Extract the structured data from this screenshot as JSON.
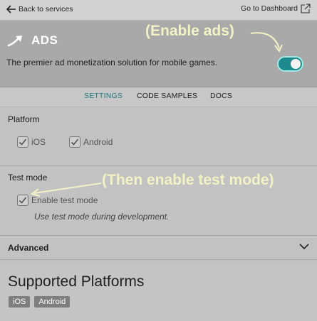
{
  "topbar": {
    "back_label": "Back to services",
    "dashboard_label": "Go to Dashboard"
  },
  "service": {
    "name": "ADS",
    "description": "The premier ad monetization solution for mobile games.",
    "enabled": true
  },
  "annotations": {
    "enable_ads": "(Enable ads)",
    "enable_test_mode": "(Then enable test mode)"
  },
  "tabs": [
    {
      "label": "SETTINGS",
      "active": true
    },
    {
      "label": "CODE SAMPLES",
      "active": false
    },
    {
      "label": "DOCS",
      "active": false
    }
  ],
  "platform": {
    "title": "Platform",
    "options": [
      {
        "label": "iOS",
        "checked": true
      },
      {
        "label": "Android",
        "checked": true
      }
    ]
  },
  "test_mode": {
    "title": "Test mode",
    "checkbox_label": "Enable test mode",
    "checked": true,
    "hint": "Use test mode during development."
  },
  "advanced": {
    "title": "Advanced"
  },
  "supported": {
    "title": "Supported Platforms",
    "platforms": [
      "iOS",
      "Android"
    ]
  },
  "colors": {
    "accent": "#1d8a8e",
    "annotation": "#f2f2c6"
  },
  "icons": [
    "back-arrow-icon",
    "external-link-icon",
    "ads-trend-arrow-icon",
    "checkmark-icon",
    "chevron-down-icon",
    "curved-arrow-icon"
  ]
}
